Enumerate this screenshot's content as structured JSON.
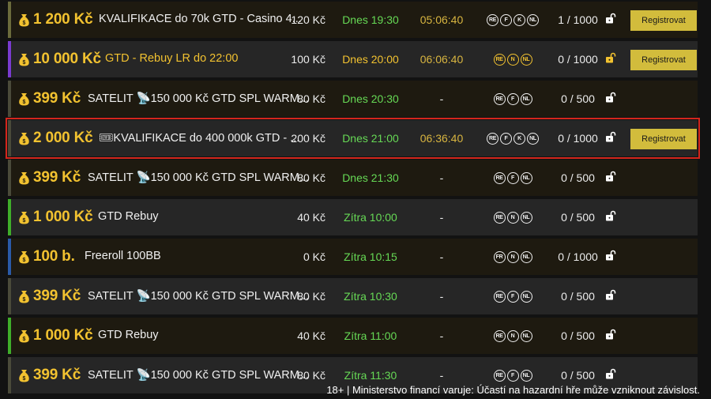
{
  "colors": {
    "accent_yellow": "#f2c230",
    "time_green": "#66d955",
    "register_bg": "#d2bc3c",
    "highlight_border": "#d4261c"
  },
  "rows": [
    {
      "prize": "1 200 Kč",
      "name": "KVALIFIKACE do 70k GTD - Casino 4...",
      "name_icon": "",
      "name_color": "white",
      "fee": "120 Kč",
      "time": "Dnes 19:30",
      "time_color": "green",
      "countdown": "05:06:40",
      "countdown_color": "yellow",
      "badges": [
        "RE",
        "F",
        "K",
        "NL"
      ],
      "badge_color": "white",
      "players": "1 / 1000",
      "lock_color": "#ffffff",
      "register": "Registrovat",
      "border": "#6b6b3c",
      "bg": "even",
      "highlight": false
    },
    {
      "prize": "10 000 Kč",
      "name": "GTD - Rebuy LR do 22:00",
      "name_icon": "",
      "name_color": "yellow",
      "fee": "100 Kč",
      "time": "Dnes 20:00",
      "time_color": "yellow",
      "countdown": "06:06:40",
      "countdown_color": "yellow",
      "badges": [
        "RE",
        "N",
        "NL"
      ],
      "badge_color": "yellow",
      "players": "0 / 1000",
      "lock_color": "#f2c230",
      "register": "Registrovat",
      "border": "#7a3bd0",
      "bg": "odd",
      "highlight": false
    },
    {
      "prize": "399 Kč",
      "name": "SATELIT 📡150 000 Kč GTD SPL WARM...",
      "name_icon": "",
      "name_color": "white",
      "fee": "80 Kč",
      "time": "Dnes 20:30",
      "time_color": "green",
      "countdown": "-",
      "countdown_color": "plain",
      "badges": [
        "RE",
        "F",
        "NL"
      ],
      "badge_color": "white",
      "players": "0 / 500",
      "lock_color": "#ffffff",
      "register": "",
      "border": "#4a4a3a",
      "bg": "even",
      "highlight": false
    },
    {
      "prize": "2 000 Kč",
      "name": "🎟KVALIFIKACE do 400 000k GTD - ...",
      "name_icon": "",
      "name_color": "white",
      "fee": "200 Kč",
      "time": "Dnes 21:00",
      "time_color": "green",
      "countdown": "06:36:40",
      "countdown_color": "yellow",
      "badges": [
        "RE",
        "F",
        "K",
        "NL"
      ],
      "badge_color": "white",
      "players": "0 / 1000",
      "lock_color": "#ffffff",
      "register": "Registrovat",
      "border": "#4a4a3a",
      "bg": "odd",
      "highlight": true
    },
    {
      "prize": "399 Kč",
      "name": "SATELIT 📡150 000 Kč GTD SPL WARM...",
      "name_icon": "",
      "name_color": "white",
      "fee": "80 Kč",
      "time": "Dnes 21:30",
      "time_color": "green",
      "countdown": "-",
      "countdown_color": "plain",
      "badges": [
        "RE",
        "F",
        "NL"
      ],
      "badge_color": "white",
      "players": "0 / 500",
      "lock_color": "#ffffff",
      "register": "",
      "border": "#4a4a3a",
      "bg": "even",
      "highlight": false
    },
    {
      "prize": "1 000 Kč",
      "name": "GTD Rebuy",
      "name_icon": "",
      "name_color": "white",
      "fee": "40 Kč",
      "time": "Zítra 10:00",
      "time_color": "green",
      "countdown": "-",
      "countdown_color": "plain",
      "badges": [
        "RE",
        "N",
        "NL"
      ],
      "badge_color": "white",
      "players": "0 / 500",
      "lock_color": "#ffffff",
      "register": "",
      "border": "#3fae2a",
      "bg": "odd",
      "highlight": false
    },
    {
      "prize": "100 b.",
      "name": "Freeroll 100BB",
      "name_icon": "",
      "name_color": "white",
      "fee": "0 Kč",
      "time": "Zítra 10:15",
      "time_color": "green",
      "countdown": "-",
      "countdown_color": "plain",
      "badges": [
        "FR",
        "N",
        "NL"
      ],
      "badge_color": "white",
      "players": "0 / 1000",
      "lock_color": "#ffffff",
      "register": "",
      "border": "#2a5aa8",
      "bg": "even",
      "highlight": false
    },
    {
      "prize": "399 Kč",
      "name": "SATELIT 📡150 000 Kč GTD SPL WARM...",
      "name_icon": "",
      "name_color": "white",
      "fee": "80 Kč",
      "time": "Zítra 10:30",
      "time_color": "green",
      "countdown": "-",
      "countdown_color": "plain",
      "badges": [
        "RE",
        "F",
        "NL"
      ],
      "badge_color": "white",
      "players": "0 / 500",
      "lock_color": "#ffffff",
      "register": "",
      "border": "#4a4a3a",
      "bg": "odd",
      "highlight": false
    },
    {
      "prize": "1 000 Kč",
      "name": "GTD Rebuy",
      "name_icon": "",
      "name_color": "white",
      "fee": "40 Kč",
      "time": "Zítra 11:00",
      "time_color": "green",
      "countdown": "-",
      "countdown_color": "plain",
      "badges": [
        "RE",
        "N",
        "NL"
      ],
      "badge_color": "white",
      "players": "0 / 500",
      "lock_color": "#ffffff",
      "register": "",
      "border": "#3fae2a",
      "bg": "even",
      "highlight": false
    },
    {
      "prize": "399 Kč",
      "name": "SATELIT 📡150 000 Kč GTD SPL WARM...",
      "name_icon": "",
      "name_color": "white",
      "fee": "80 Kč",
      "time": "Zítra 11:30",
      "time_color": "green",
      "countdown": "-",
      "countdown_color": "plain",
      "badges": [
        "RE",
        "F",
        "NL"
      ],
      "badge_color": "white",
      "players": "0 / 500",
      "lock_color": "#ffffff",
      "register": "",
      "border": "#4a4a3a",
      "bg": "odd",
      "highlight": false
    }
  ],
  "footer": {
    "warning": "18+ | Ministerstvo financí varuje: Účastí na hazardní hře může vzniknout závislost."
  }
}
